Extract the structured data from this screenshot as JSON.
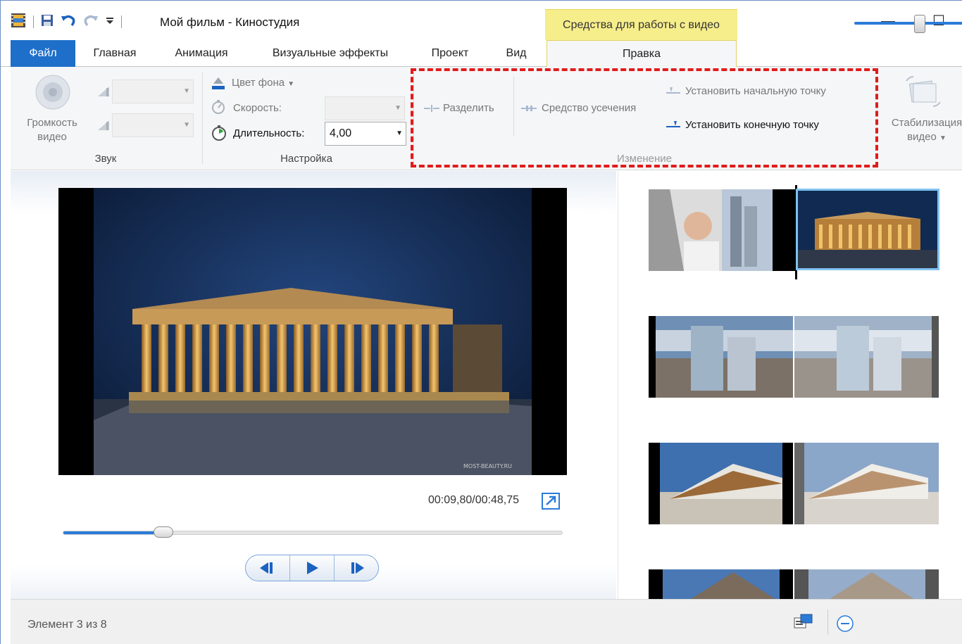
{
  "window": {
    "title": "Мой фильм - Киностудия",
    "context_tab_header": "Средства для работы с видео",
    "minimize_glyph": "—",
    "maximize_glyph": "☐"
  },
  "tabs": {
    "file": "Файл",
    "home": "Главная",
    "animation": "Анимация",
    "visual_effects": "Визуальные эффекты",
    "project": "Проект",
    "view": "Вид",
    "edit": "Правка"
  },
  "ribbon": {
    "sound": {
      "video_volume_line1": "Громкость",
      "video_volume_line2": "видео",
      "group_label": "Звук"
    },
    "settings": {
      "background_color": "Цвет фона",
      "speed_label": "Скорость:",
      "duration_label": "Длительность:",
      "duration_value": "4,00",
      "group_label": "Настройка"
    },
    "editing": {
      "split": "Разделить",
      "trim_tool": "Средство усечения",
      "set_start_point": "Установить начальную точку",
      "set_end_point": "Установить конечную точку",
      "group_label": "Изменение"
    },
    "stabilization": {
      "line1": "Стабилизация",
      "line2": "видео"
    }
  },
  "player": {
    "time": "00:09,80/00:48,75",
    "progress": 0.2,
    "watermark": "MOST-BEAUTY.RU"
  },
  "status": {
    "element_text": "Элемент 3 из 8",
    "zoom_level": 0.62
  },
  "colors": {
    "accent": "#1e6fc9",
    "context_tab": "#f6ed8b",
    "highlight_box": "#e11b1b",
    "selection": "#7fc2ef"
  }
}
